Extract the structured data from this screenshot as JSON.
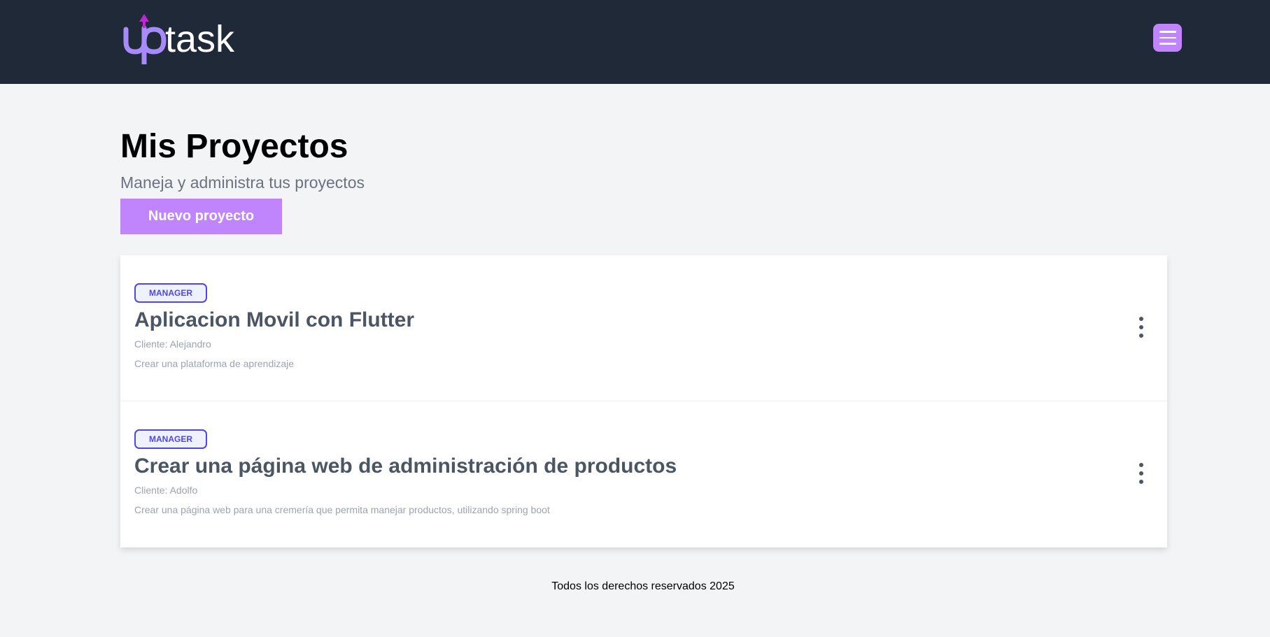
{
  "brand": {
    "logo_text_up": "up",
    "logo_text_task": "task"
  },
  "header": {
    "menu_icon": "hamburger-menu-icon"
  },
  "main": {
    "title": "Mis Proyectos",
    "subtitle": "Maneja y administra tus proyectos",
    "new_project_label": "Nuevo proyecto"
  },
  "projects": [
    {
      "role": "MANAGER",
      "name": "Aplicacion Movil con Flutter",
      "client": "Cliente: Alejandro",
      "description": "Crear una plataforma de aprendizaje"
    },
    {
      "role": "MANAGER",
      "name": "Crear una página web de administración de productos",
      "client": "Cliente: Adolfo",
      "description": "Crear una página web para una cremería que permita manejar productos, utilizando spring boot"
    }
  ],
  "footer": {
    "text": "Todos los derechos reservados 2025"
  },
  "colors": {
    "header_bg": "#1f2937",
    "accent": "#c084fc",
    "badge": "#4f46e5",
    "page_bg": "#f3f4f6"
  }
}
